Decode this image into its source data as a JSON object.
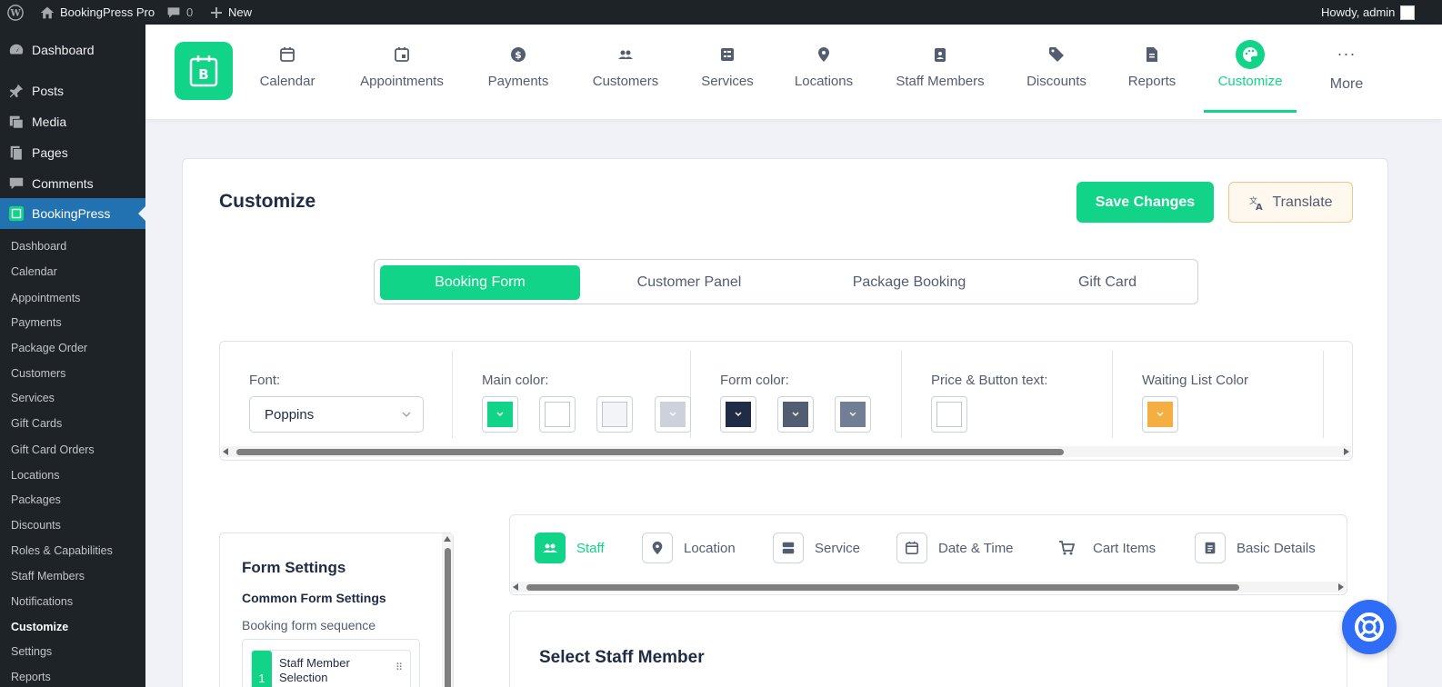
{
  "admin_bar": {
    "site_name": "BookingPress Pro",
    "comments_count": "0",
    "new_label": "New",
    "howdy": "Howdy, admin"
  },
  "sidebar": {
    "top_items": [
      {
        "label": "Dashboard",
        "icon": "dashboard-icon"
      },
      {
        "label": "Posts",
        "icon": "pin-icon"
      },
      {
        "label": "Media",
        "icon": "media-icon"
      },
      {
        "label": "Pages",
        "icon": "pages-icon"
      },
      {
        "label": "Comments",
        "icon": "comment-icon"
      },
      {
        "label": "BookingPress",
        "icon": "bookingpress-icon"
      }
    ],
    "sub_items": [
      "Dashboard",
      "Calendar",
      "Appointments",
      "Payments",
      "Package Order",
      "Customers",
      "Services",
      "Gift Cards",
      "Gift Card Orders",
      "Locations",
      "Packages",
      "Discounts",
      "Roles & Capabilities",
      "Staff Members",
      "Notifications",
      "Customize",
      "Settings",
      "Reports"
    ],
    "current_sub": "Customize"
  },
  "nav": {
    "items": [
      {
        "label": "Calendar",
        "icon": "calendar-icon"
      },
      {
        "label": "Appointments",
        "icon": "appointments-icon"
      },
      {
        "label": "Payments",
        "icon": "dollar-icon"
      },
      {
        "label": "Customers",
        "icon": "users-icon"
      },
      {
        "label": "Services",
        "icon": "services-icon"
      },
      {
        "label": "Locations",
        "icon": "location-pin-icon"
      },
      {
        "label": "Staff Members",
        "icon": "staff-badge-icon"
      },
      {
        "label": "Discounts",
        "icon": "tag-icon"
      },
      {
        "label": "Reports",
        "icon": "report-icon"
      },
      {
        "label": "Customize",
        "icon": "palette-icon"
      },
      {
        "label": "More",
        "icon": "ellipsis-icon"
      }
    ],
    "active": "Customize",
    "accent": "#12d488"
  },
  "page": {
    "title": "Customize",
    "save_label": "Save Changes",
    "translate_label": "Translate"
  },
  "tabs": [
    "Booking Form",
    "Customer Panel",
    "Package Booking",
    "Gift Card"
  ],
  "colors_panel": {
    "font_label": "Font:",
    "font_value": "Poppins",
    "main_color_label": "Main color:",
    "form_color_label": "Form color:",
    "price_label": "Price & Button text:",
    "waiting_label": "Waiting List Color",
    "main_colors": [
      "#12d488",
      "#ffffff",
      "#f3f4f7",
      "#cdd1db"
    ],
    "form_colors": [
      "#202c45",
      "#535d71",
      "#727e95"
    ],
    "price_colors": [
      "#ffffff"
    ],
    "waiting_colors": [
      "#f5ae41"
    ]
  },
  "form_settings": {
    "title": "Form Settings",
    "common": "Common Form Settings",
    "sequence_label": "Booking form sequence",
    "sequence": [
      {
        "num": "1",
        "label_line1": "Staff Member",
        "label_line2": "Selection"
      }
    ]
  },
  "steps": [
    {
      "label": "Staff",
      "icon": "users-icon"
    },
    {
      "label": "Location",
      "icon": "location-pin-icon"
    },
    {
      "label": "Service",
      "icon": "services-icon"
    },
    {
      "label": "Date & Time",
      "icon": "calendar-icon"
    },
    {
      "label": "Cart Items",
      "icon": "cart-icon"
    },
    {
      "label": "Basic Details",
      "icon": "document-icon"
    }
  ],
  "select_panel": {
    "title": "Select Staff Member"
  }
}
